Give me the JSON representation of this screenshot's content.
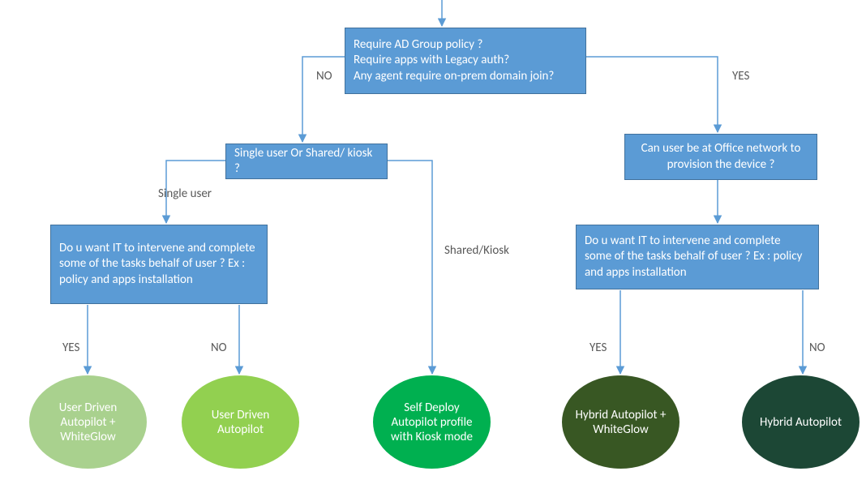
{
  "nodes": {
    "root": {
      "line1": "Require AD Group policy ?",
      "line2": "Require apps with Legacy auth?",
      "line3": "Any agent require on-prem domain join?"
    },
    "single_shared": "Single user Or Shared/ kiosk ?",
    "office_network": "Can user  be at Office network to provision the device ?",
    "it_intervene_left": "Do u want IT to intervene and complete some of the tasks behalf of user ? Ex : policy and apps installation",
    "it_intervene_right": "Do u want IT to intervene and complete some of the tasks behalf of user ? Ex : policy and apps installation"
  },
  "labels": {
    "no_top": "NO",
    "yes_top": "YES",
    "single_user": "Single user",
    "shared_kiosk": "Shared/Kiosk",
    "yes_left": "YES",
    "no_left": "NO",
    "yes_right": "YES",
    "no_right": "NO"
  },
  "outcomes": {
    "user_driven_whiteglow": "User Driven Autopilot + WhiteGlow",
    "user_driven": "User Driven Autopilot",
    "self_deploy": "Self Deploy Autopilot profile with Kiosk mode",
    "hybrid_whiteglow": "Hybrid Autopilot + WhiteGlow",
    "hybrid": "Hybrid Autopilot"
  },
  "colors": {
    "box_fill": "#5b9bd5",
    "box_border": "#41719c",
    "ellipse1": "#a9d18e",
    "ellipse2": "#92d050",
    "ellipse3": "#00b050",
    "ellipse4": "#385723",
    "ellipse5": "#1c4735",
    "label": "#595959",
    "connector": "#5b9bd5"
  }
}
